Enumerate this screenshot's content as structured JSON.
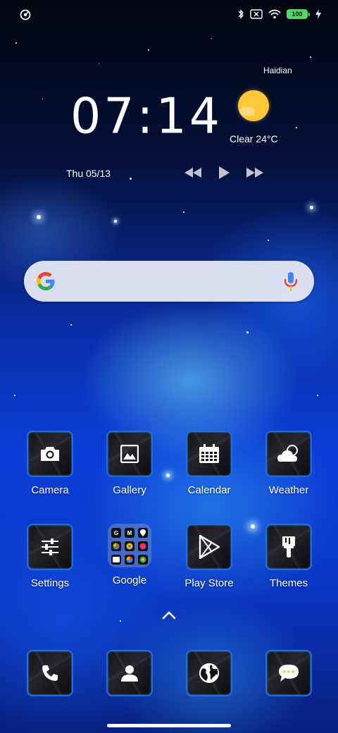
{
  "status_bar": {
    "left_icon": "focus-ring-icon",
    "icons": [
      "bluetooth-icon",
      "sim-off-icon",
      "wifi-icon",
      "battery-icon",
      "charging-bolt-icon"
    ],
    "battery_level": "100"
  },
  "clock_widget": {
    "time": "07:14",
    "date": "Thu 05/13",
    "location": "Haidian",
    "weather": "Clear  24°C",
    "weather_icon": "sun-icon",
    "media_controls": [
      "previous-icon",
      "play-icon",
      "next-icon"
    ]
  },
  "search_bar": {
    "logo": "google-g-icon",
    "mic": "microphone-icon"
  },
  "apps": {
    "row1": [
      {
        "label": "Camera",
        "icon": "camera-icon"
      },
      {
        "label": "Gallery",
        "icon": "image-icon"
      },
      {
        "label": "Calendar",
        "icon": "calendar-icon"
      },
      {
        "label": "Weather",
        "icon": "cloud-moon-icon"
      }
    ],
    "row2": [
      {
        "label": "Settings",
        "icon": "sliders-icon"
      },
      {
        "label": "Google",
        "icon": "folder-icon"
      },
      {
        "label": "Play Store",
        "icon": "play-store-icon"
      },
      {
        "label": "Themes",
        "icon": "paintbrush-icon"
      }
    ]
  },
  "folder_minis": [
    "G",
    "M",
    "maps",
    "photos",
    "chrome",
    "drive",
    "duo",
    "play",
    "meet"
  ],
  "dock": [
    "phone-icon",
    "contacts-icon",
    "browser-icon",
    "messages-icon"
  ],
  "colors": {
    "accent_border": "#1f6de0",
    "sun": "#ffc73a",
    "battery": "#4cd964"
  }
}
